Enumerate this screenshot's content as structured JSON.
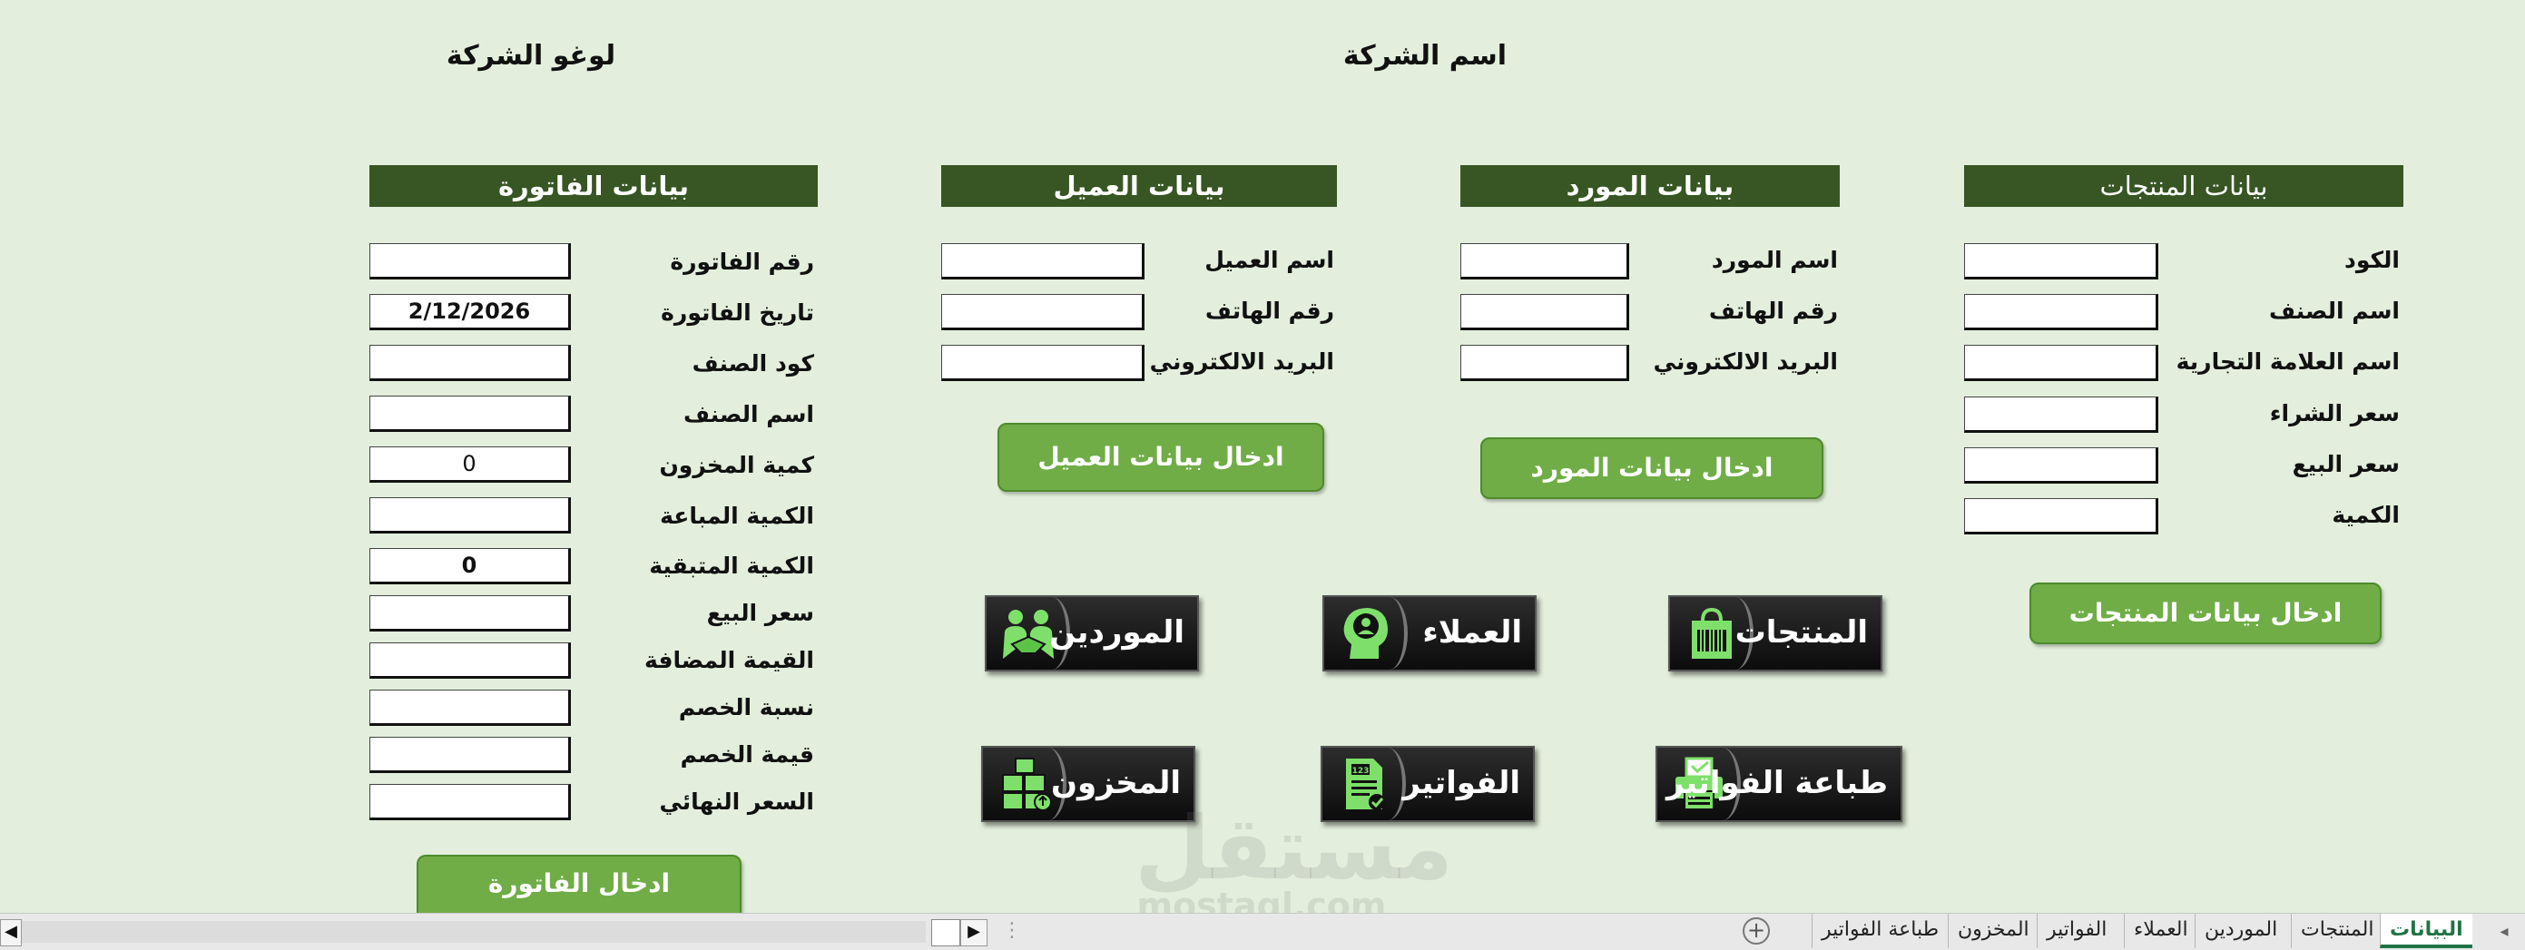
{
  "header": {
    "company_name": "اسم الشركة",
    "company_logo": "لوغو الشركة"
  },
  "products": {
    "title": "بيانات المنتجات",
    "fields": [
      "الكود",
      "اسم الصنف",
      "اسم العلامة التجارية",
      "سعر الشراء",
      "سعر البيع",
      "الكمية"
    ],
    "button": "ادخال بيانات المنتجات"
  },
  "supplier": {
    "title": "بيانات المورد",
    "fields": [
      "اسم المورد",
      "رقم الهاتف",
      "البريد الالكتروني"
    ],
    "button": "ادخال بيانات المورد"
  },
  "customer": {
    "title": "بيانات العميل",
    "fields": [
      "اسم العميل",
      "رقم الهاتف",
      "البريد الالكتروني"
    ],
    "button": "ادخال بيانات العميل"
  },
  "invoice": {
    "title": "بيانات الفاتورة",
    "fields": [
      {
        "label": "رقم الفاتورة",
        "value": ""
      },
      {
        "label": "تاريخ الفاتورة",
        "value": "2/12/2026"
      },
      {
        "label": "كود الصنف",
        "value": ""
      },
      {
        "label": "اسم الصنف",
        "value": ""
      },
      {
        "label": "كمية المخزون",
        "value": "0"
      },
      {
        "label": "الكمية المباعة",
        "value": ""
      },
      {
        "label": "الكمية المتبقية",
        "value": "0"
      },
      {
        "label": "سعر البيع",
        "value": ""
      },
      {
        "label": "القيمة المضافة",
        "value": ""
      },
      {
        "label": "نسبة الخصم",
        "value": ""
      },
      {
        "label": "قيمة الخصم",
        "value": ""
      },
      {
        "label": "السعر النهائي",
        "value": ""
      }
    ],
    "button": "ادخال الفاتورة"
  },
  "nav_buttons": {
    "products": {
      "label": "المنتجات",
      "icon": "shopping-bag-barcode-icon"
    },
    "customers": {
      "label": "العملاء",
      "icon": "head-person-icon"
    },
    "suppliers": {
      "label": "الموردين",
      "icon": "handshake-icon"
    },
    "print_invoices": {
      "label": "طباعة الفواتير",
      "icon": "printer-icon"
    },
    "invoices": {
      "label": "الفواتير",
      "icon": "invoice-document-icon"
    },
    "inventory": {
      "label": "المخزون",
      "icon": "boxes-icon"
    }
  },
  "watermark": {
    "arabic": "مستقل",
    "latin": "mostaql.com"
  },
  "sheet_tabs": [
    "البيانات",
    "المنتجات",
    "الموردين",
    "العملاء",
    "الفواتير",
    "المخزون",
    "طباعة الفواتير"
  ],
  "active_tab": "البيانات",
  "colors": {
    "background": "#e3efdc",
    "header": "#375623",
    "button": "#70ad47",
    "tab_active": "#217346"
  }
}
